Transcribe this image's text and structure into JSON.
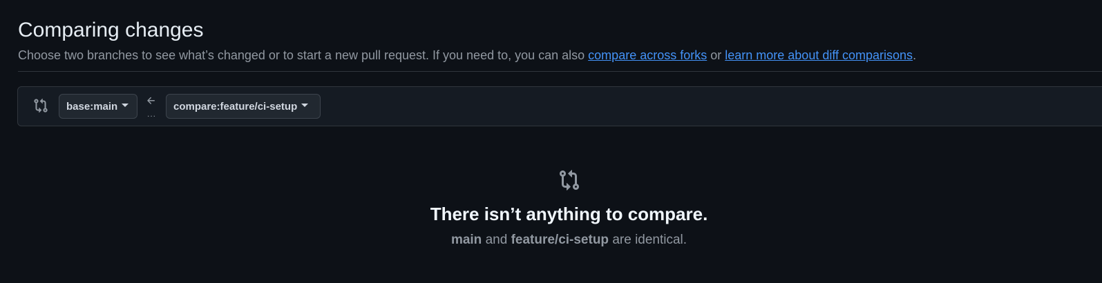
{
  "header": {
    "title": "Comparing changes",
    "description_prefix": "Choose two branches to see what’s changed or to start a new pull request. If you need to, you can also ",
    "link_forks": "compare across forks",
    "description_or": " or ",
    "link_learn": "learn more about diff comparisons",
    "description_suffix": "."
  },
  "range": {
    "icon": "git-compare-icon",
    "base_prefix": "base: ",
    "base_branch": "main",
    "arrow_icon": "arrow-left-icon",
    "dots": "...",
    "compare_prefix": "compare: ",
    "compare_branch": "feature/ci-setup"
  },
  "blankslate": {
    "icon": "git-compare-icon",
    "title": "There isn’t anything to compare.",
    "branch_a": "main",
    "and_text": " and ",
    "branch_b": "feature/ci-setup",
    "suffix": " are identical."
  },
  "colors": {
    "background": "#0d1117",
    "link": "#4493f8",
    "border": "#30363d",
    "muted": "#9198a1"
  }
}
